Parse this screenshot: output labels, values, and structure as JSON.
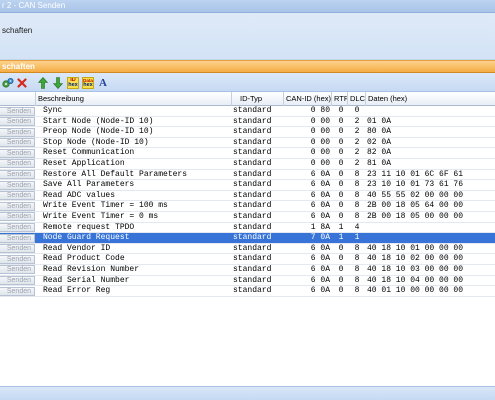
{
  "window": {
    "title": "r 2 - CAN Senden"
  },
  "info_panel": {
    "text": "schaften"
  },
  "properties_header": {
    "title": "schaften"
  },
  "toolbar": {
    "id_badge_top": "ID",
    "id_badge_bottom": "hex",
    "data_badge_top": "Data",
    "data_badge_bottom": "hex",
    "font_label": "A"
  },
  "table": {
    "columns": {
      "beschreibung": "Beschreibung",
      "idtyp": "ID-Typ",
      "canid": "CAN-ID (hex)",
      "rtr": "RTR",
      "dlc": "DLC",
      "daten": "Daten (hex)"
    },
    "send_label": "Senden",
    "rows": [
      {
        "desc": "Sync",
        "idtyp": "standard",
        "canid": "0 80",
        "rtr": "0",
        "dlc": "0",
        "data": ""
      },
      {
        "desc": "Start Node (Node-ID 10)",
        "idtyp": "standard",
        "canid": "0 00",
        "rtr": "0",
        "dlc": "2",
        "data": "01 0A"
      },
      {
        "desc": "Preop Node (Node-ID 10)",
        "idtyp": "standard",
        "canid": "0 00",
        "rtr": "0",
        "dlc": "2",
        "data": "80 0A"
      },
      {
        "desc": "Stop Node (Node-ID 10)",
        "idtyp": "standard",
        "canid": "0 00",
        "rtr": "0",
        "dlc": "2",
        "data": "02 0A"
      },
      {
        "desc": "Reset Communication",
        "idtyp": "standard",
        "canid": "0 00",
        "rtr": "0",
        "dlc": "2",
        "data": "82 0A"
      },
      {
        "desc": "Reset Application",
        "idtyp": "standard",
        "canid": "0 00",
        "rtr": "0",
        "dlc": "2",
        "data": "81 0A"
      },
      {
        "desc": "Restore All Default Parameters",
        "idtyp": "standard",
        "canid": "6 0A",
        "rtr": "0",
        "dlc": "8",
        "data": "23 11 10 01 6C 6F 61"
      },
      {
        "desc": "Save All Parameters",
        "idtyp": "standard",
        "canid": "6 0A",
        "rtr": "0",
        "dlc": "8",
        "data": "23 10 10 01 73 61 76"
      },
      {
        "desc": "Read ADC values",
        "idtyp": "standard",
        "canid": "6 0A",
        "rtr": "0",
        "dlc": "8",
        "data": "40 55 55 02 00 00 00"
      },
      {
        "desc": "Write Event Timer = 100 ms",
        "idtyp": "standard",
        "canid": "6 0A",
        "rtr": "0",
        "dlc": "8",
        "data": "2B 00 18 05 64 00 00"
      },
      {
        "desc": "Write Event Timer = 0 ms",
        "idtyp": "standard",
        "canid": "6 0A",
        "rtr": "0",
        "dlc": "8",
        "data": "2B 00 18 05 00 00 00"
      },
      {
        "desc": "Remote request TPDO",
        "idtyp": "standard",
        "canid": "1 8A",
        "rtr": "1",
        "dlc": "4",
        "data": ""
      },
      {
        "desc": "Node Guard Request",
        "idtyp": "standard",
        "canid": "7 0A",
        "rtr": "1",
        "dlc": "1",
        "data": "",
        "selected": true
      },
      {
        "desc": "Read Vendor ID",
        "idtyp": "standard",
        "canid": "6 0A",
        "rtr": "0",
        "dlc": "8",
        "data": "40 18 10 01 00 00 00"
      },
      {
        "desc": "Read Product Code",
        "idtyp": "standard",
        "canid": "6 0A",
        "rtr": "0",
        "dlc": "8",
        "data": "40 18 10 02 00 00 00"
      },
      {
        "desc": "Read Revision Number",
        "idtyp": "standard",
        "canid": "6 0A",
        "rtr": "0",
        "dlc": "8",
        "data": "40 18 10 03 00 00 00"
      },
      {
        "desc": "Read Serial Number",
        "idtyp": "standard",
        "canid": "6 0A",
        "rtr": "0",
        "dlc": "8",
        "data": "40 18 10 04 00 00 00"
      },
      {
        "desc": "Read Error Reg",
        "idtyp": "standard",
        "canid": "6 0A",
        "rtr": "0",
        "dlc": "8",
        "data": "40 01 10 00 00 00 00"
      }
    ]
  }
}
